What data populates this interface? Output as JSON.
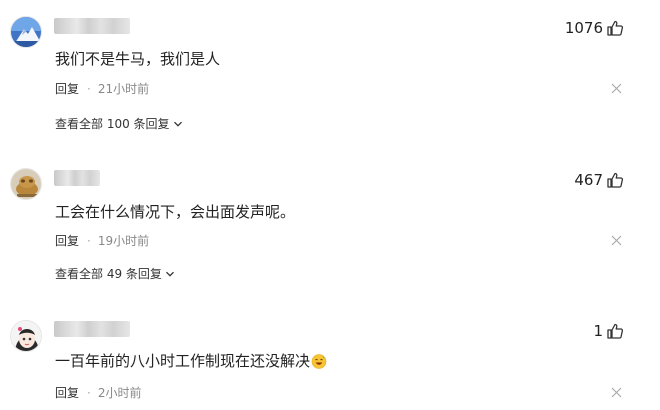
{
  "comments": [
    {
      "likes": "1076",
      "text": "我们不是牛马，我们是人",
      "reply_label": "回复",
      "separator": "·",
      "time": "21小时前",
      "view_all": "查看全部 100 条回复"
    },
    {
      "likes": "467",
      "text": "工会在什么情况下，会出面发声呢。",
      "reply_label": "回复",
      "separator": "·",
      "time": "19小时前",
      "view_all": "查看全部 49 条回复"
    },
    {
      "likes": "1",
      "text": "一百年前的八小时工作制现在还没解决",
      "reply_label": "回复",
      "separator": "·",
      "time": "2小时前"
    }
  ],
  "icons": {
    "like": "thumbs-up-icon",
    "delete": "close-icon",
    "expand": "chevron-down-icon",
    "emoji": "sweat-smile-emoji"
  },
  "colors": {
    "text": "#222222",
    "secondary": "#888888",
    "background": "#ffffff"
  }
}
